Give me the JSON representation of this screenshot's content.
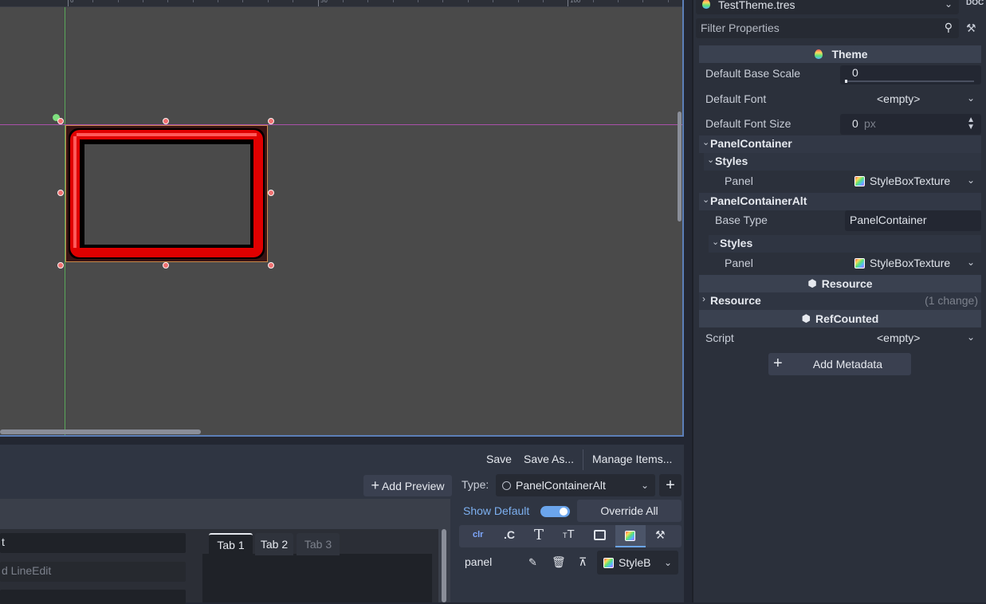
{
  "viewport": {
    "ruler_labels": [
      "0",
      "50",
      "100"
    ]
  },
  "bottom": {
    "save_label": "Save",
    "save_as_label": "Save As...",
    "manage_items_label": "Manage Items...",
    "add_preview_label": "Add Preview",
    "type_label": "Type:",
    "type_value": "PanelContainerAlt",
    "show_default_label": "Show Default",
    "show_default_on": true,
    "override_all_label": "Override All",
    "toolbar_icons": [
      "color-icon",
      "constant-icon",
      "font-icon",
      "font-size-icon",
      "image-icon",
      "stylebox-icon",
      "type-settings-icon"
    ],
    "item_name": "panel",
    "item_value": "StyleB",
    "preview": {
      "lineedit_1": "t",
      "lineedit_2_placeholder": "d LineEdit",
      "tabs": [
        "Tab 1",
        "Tab 2",
        "Tab 3"
      ]
    }
  },
  "inspector": {
    "resource_name": "TestTheme.tres",
    "filter_placeholder": "Filter Properties",
    "theme_section": "Theme",
    "default_base_scale_label": "Default Base Scale",
    "default_base_scale_value": "0",
    "default_font_label": "Default Font",
    "default_font_value": "<empty>",
    "default_font_size_label": "Default Font Size",
    "default_font_size_value": "0",
    "default_font_size_unit": "px",
    "panel_container": "PanelContainer",
    "styles_1": "Styles",
    "panel_1_label": "Panel",
    "panel_1_value": "StyleBoxTexture",
    "panel_container_alt": "PanelContainerAlt",
    "base_type_label": "Base Type",
    "base_type_value": "PanelContainer",
    "styles_2": "Styles",
    "panel_2_label": "Panel",
    "panel_2_value": "StyleBoxTexture",
    "resource_section": "Resource",
    "resource_group": "Resource",
    "resource_changes": "(1 change)",
    "refcounted_section": "RefCounted",
    "script_label": "Script",
    "script_value": "<empty>",
    "add_metadata_label": "Add Metadata"
  }
}
